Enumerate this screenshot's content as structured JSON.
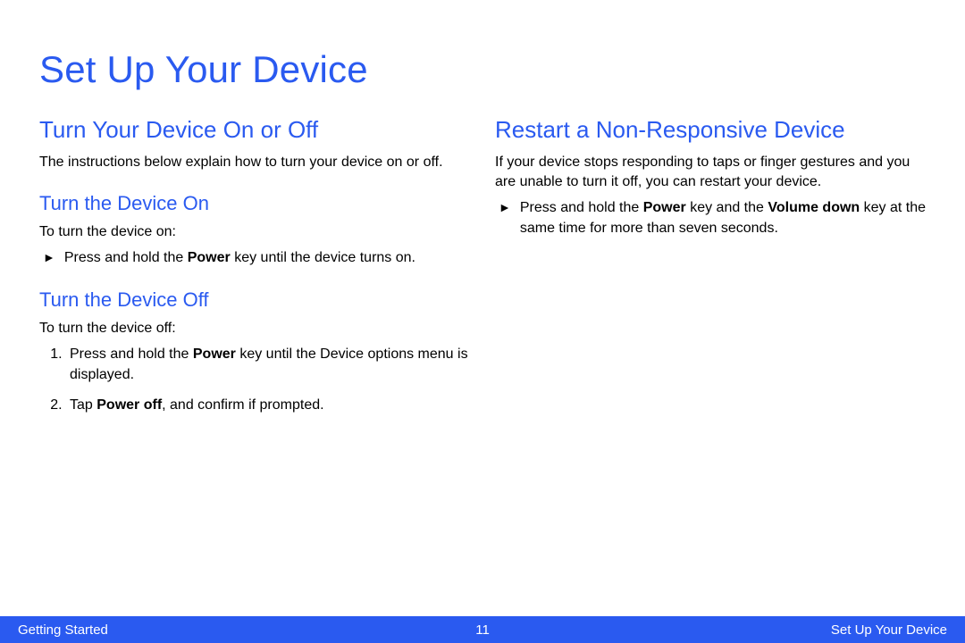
{
  "title": "Set Up Your Device",
  "left": {
    "heading": "Turn Your Device On or Off",
    "intro": "The instructions below explain how to turn your device on or off.",
    "on": {
      "heading": "Turn the Device On",
      "lead": "To turn the device on:",
      "bullet_pre": "Press and hold the ",
      "bullet_bold": "Power",
      "bullet_post": " key until the device turns on."
    },
    "off": {
      "heading": "Turn the Device Off",
      "lead": "To turn the device off:",
      "step1_pre": "Press and hold the ",
      "step1_bold": "Power",
      "step1_post": " key until the Device options menu is displayed.",
      "step2_pre": "Tap ",
      "step2_bold": "Power off",
      "step2_post": ", and confirm if prompted."
    }
  },
  "right": {
    "heading": "Restart a Non-Responsive Device",
    "intro": "If your device stops responding to taps or finger gestures and you are unable to turn it off, you can restart your device.",
    "bullet_pre": "Press and hold the ",
    "bullet_bold1": "Power",
    "bullet_mid": " key and the ",
    "bullet_bold2": "Volume down",
    "bullet_post": " key at the same time for more than seven seconds."
  },
  "footer": {
    "left": "Getting Started",
    "center": "11",
    "right": "Set Up Your Device"
  },
  "glyphs": {
    "triangle": "►"
  }
}
